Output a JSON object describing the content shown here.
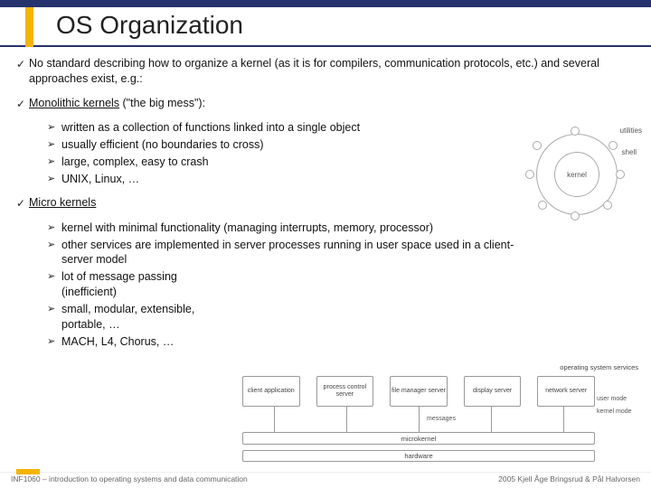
{
  "title": "OS Organization",
  "bullets": {
    "b1": "No standard describing how to organize a kernel (as it is for compilers, communication protocols, etc.) and several approaches exist, e.g.:",
    "b2_prefix": "Monolithic kernels",
    "b2_suffix": " (\"the big mess\"):",
    "b2_items": {
      "i1": "written as a collection of functions linked into a single object",
      "i2": "usually efficient (no boundaries to cross)",
      "i3": "large, complex, easy to crash",
      "i4": "UNIX, Linux, …"
    },
    "b3": "Micro kernels",
    "b3_items": {
      "i1": "kernel with minimal functionality (managing interrupts, memory, processor)",
      "i2": "other services are implemented in server processes running in user space used in a client-server model",
      "i3": "lot of message passing (inefficient)",
      "i4": "small, modular, extensible, portable, …",
      "i5": "MACH, L4, Chorus, …"
    }
  },
  "dia1": {
    "shell": "shell",
    "kernel": "kernel",
    "utilities": "utilities"
  },
  "dia2": {
    "os_services": "operating system services",
    "boxes": {
      "b1": "client application",
      "b2": "process control server",
      "b3": "file manager server",
      "b4": "display server",
      "b5": "network server"
    },
    "mk": "microkernel",
    "hw": "hardware",
    "messages": "messages",
    "user_mode": "user mode",
    "kernel_mode": "kernel mode"
  },
  "footer": {
    "left": "INF1060 – introduction to operating systems and data communication",
    "right": "2005 Kjell Åge Bringsrud & Pål Halvorsen"
  }
}
